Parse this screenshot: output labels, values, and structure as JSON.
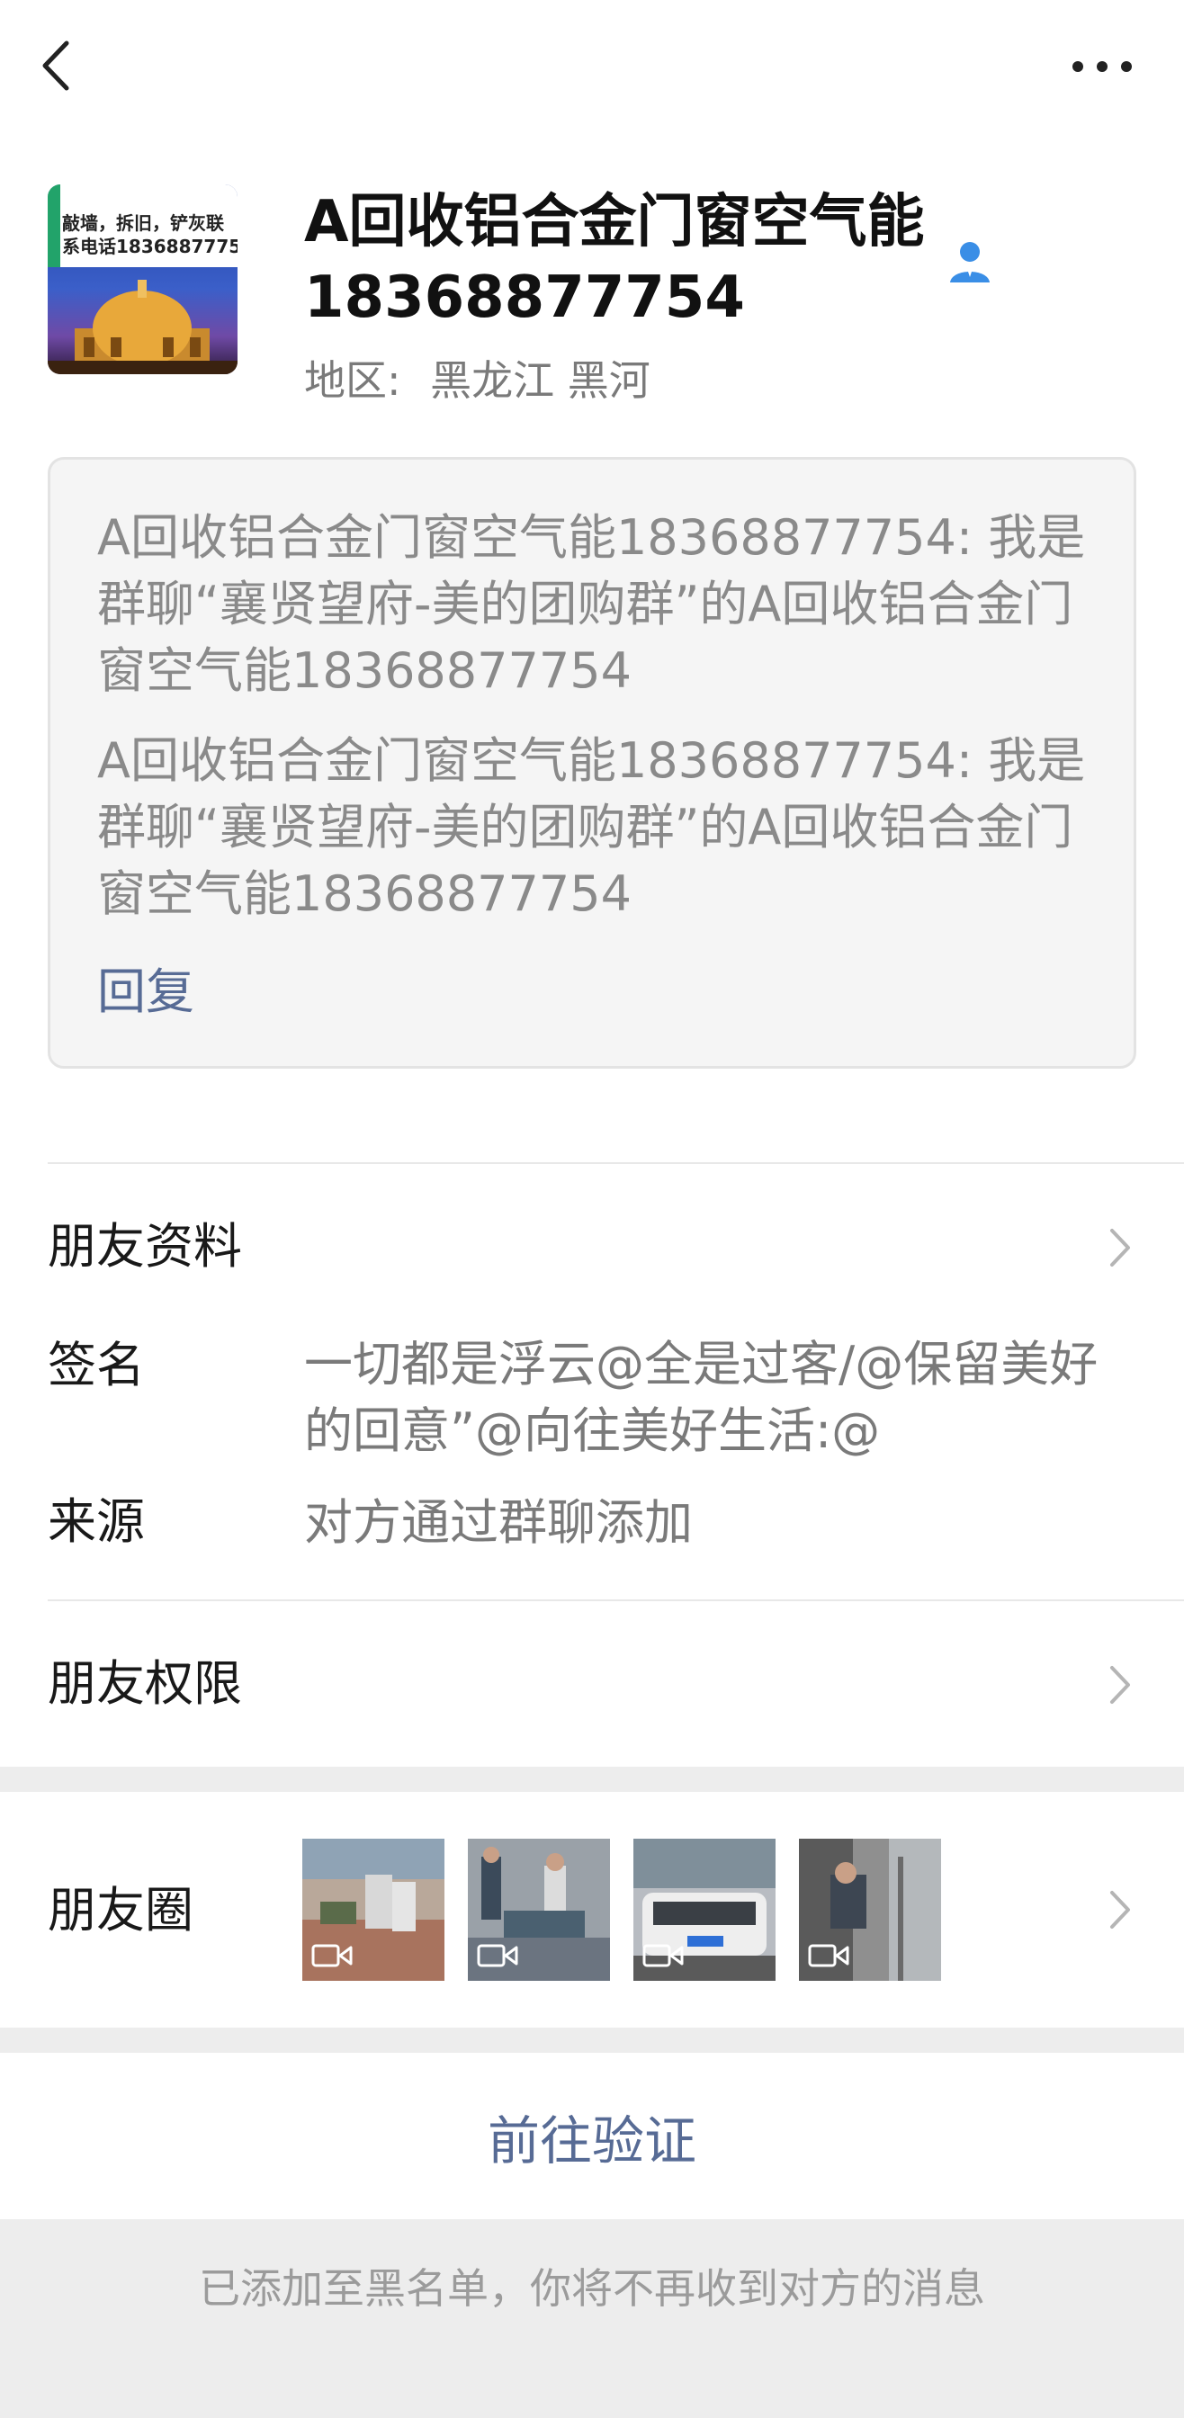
{
  "header": {
    "back_icon": "chevron-left-icon",
    "more_icon": "ellipsis-icon"
  },
  "profile": {
    "avatar_text_line1": "敲墙，拆旧，铲灰联",
    "avatar_text_line2": "系电话18368877754",
    "name": "A回收铝合金门窗空气能18368877754",
    "verified_icon": "user-verified-icon",
    "region_label": "地区:",
    "region_value": "黑龙江  黑河"
  },
  "greeting": {
    "messages": [
      "A回收铝合金门窗空气能18368877754: 我是群聊“襄贤望府-美的团购群”的A回收铝合金门窗空气能18368877754",
      "A回收铝合金门窗空气能18368877754: 我是群聊“襄贤望府-美的团购群”的A回收铝合金门窗空气能18368877754"
    ],
    "reply_label": "回复"
  },
  "info": {
    "friend_profile_label": "朋友资料",
    "signature_label": "签名",
    "signature_value": "一切都是浮云@全是过客/@保留美好的回意”@向往美好生活:@",
    "source_label": "来源",
    "source_value": "对方通过群聊添加",
    "permissions_label": "朋友权限"
  },
  "moments": {
    "label": "朋友圈",
    "thumbnails": [
      "video-thumbnail",
      "video-thumbnail",
      "video-thumbnail",
      "video-thumbnail"
    ]
  },
  "actions": {
    "verify_label": "前往验证",
    "blacklist_note": "已添加至黑名单，你将不再收到对方的消息"
  },
  "colors": {
    "link": "#576b95",
    "secondary_text": "#7a7a7a",
    "band": "#ededed"
  }
}
